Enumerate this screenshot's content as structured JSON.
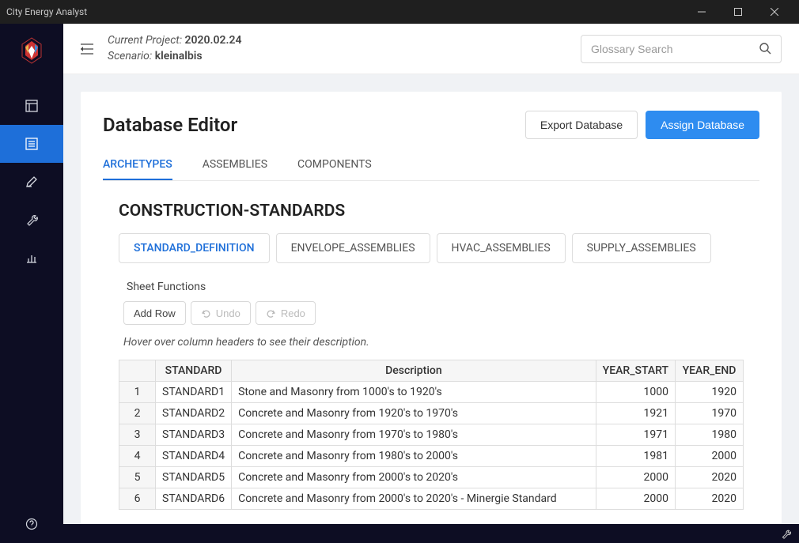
{
  "window_title": "City Energy Analyst",
  "header": {
    "project_label": "Current Project: ",
    "project_value": "2020.02.24",
    "scenario_label": "Scenario: ",
    "scenario_value": "kleinalbis",
    "search_placeholder": "Glossary Search"
  },
  "page": {
    "title": "Database Editor",
    "export_btn": "Export Database",
    "assign_btn": "Assign Database"
  },
  "main_tabs": [
    "ARCHETYPES",
    "ASSEMBLIES",
    "COMPONENTS"
  ],
  "section_title": "CONSTRUCTION-STANDARDS",
  "sub_tabs": [
    "STANDARD_DEFINITION",
    "ENVELOPE_ASSEMBLIES",
    "HVAC_ASSEMBLIES",
    "SUPPLY_ASSEMBLIES"
  ],
  "sheet_functions_label": "Sheet Functions",
  "toolbar": {
    "add_row": "Add Row",
    "undo": "Undo",
    "redo": "Redo"
  },
  "hint": "Hover over column headers to see their description.",
  "table": {
    "headers": [
      "STANDARD",
      "Description",
      "YEAR_START",
      "YEAR_END"
    ],
    "rows": [
      {
        "n": "1",
        "standard": "STANDARD1",
        "description": "Stone and Masonry from 1000's to 1920's",
        "year_start": "1000",
        "year_end": "1920"
      },
      {
        "n": "2",
        "standard": "STANDARD2",
        "description": "Concrete and Masonry from 1920's to 1970's",
        "year_start": "1921",
        "year_end": "1970"
      },
      {
        "n": "3",
        "standard": "STANDARD3",
        "description": "Concrete and Masonry from 1970's to 1980's",
        "year_start": "1971",
        "year_end": "1980"
      },
      {
        "n": "4",
        "standard": "STANDARD4",
        "description": "Concrete and Masonry from 1980's to 2000's",
        "year_start": "1981",
        "year_end": "2000"
      },
      {
        "n": "5",
        "standard": "STANDARD5",
        "description": "Concrete and Masonry from 2000's to 2020's",
        "year_start": "2000",
        "year_end": "2020"
      },
      {
        "n": "6",
        "standard": "STANDARD6",
        "description": "Concrete and Masonry from 2000's to 2020's - Minergie Standard",
        "year_start": "2000",
        "year_end": "2020"
      }
    ]
  }
}
